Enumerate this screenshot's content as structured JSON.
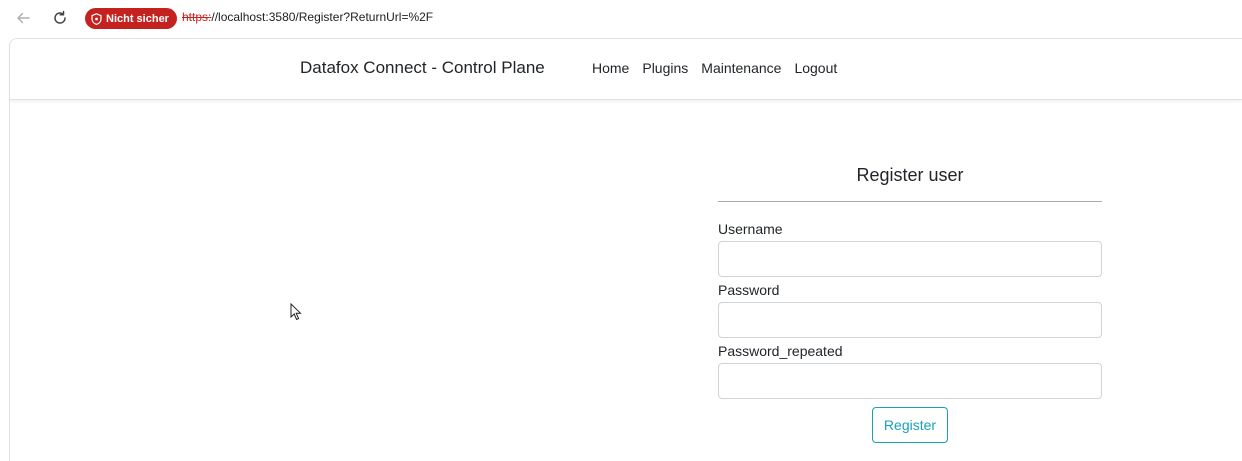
{
  "browser": {
    "security_label": "Nicht sicher",
    "url_scheme": "https:",
    "url_rest": "//localhost:3580/Register?ReturnUrl=%2F",
    "icons": [
      "back-arrow-icon",
      "reload-icon",
      "shield-icon"
    ],
    "security_color": "#c5221f"
  },
  "navbar": {
    "brand": "Datafox Connect - Control Plane",
    "links": [
      {
        "label": "Home"
      },
      {
        "label": "Plugins"
      },
      {
        "label": "Maintenance"
      },
      {
        "label": "Logout"
      }
    ]
  },
  "form": {
    "title": "Register user",
    "fields": [
      {
        "label": "Username",
        "value": ""
      },
      {
        "label": "Password",
        "value": ""
      },
      {
        "label": "Password_repeated",
        "value": ""
      }
    ],
    "submit_label": "Register",
    "accent_color": "#17a2b8"
  }
}
